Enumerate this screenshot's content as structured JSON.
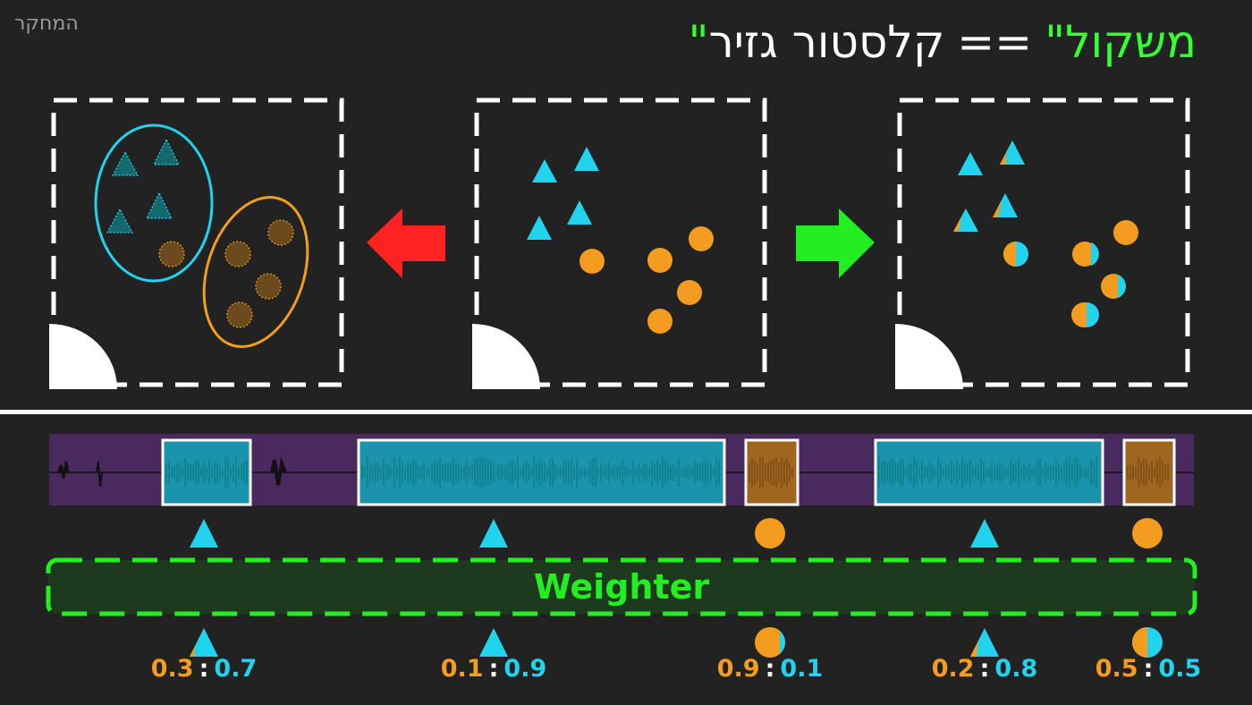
{
  "header": {
    "corner_label": "המחקר",
    "title_main": "קלסטור גזיר",
    "title_equals": "==",
    "title_highlight": "\"משקול\""
  },
  "colors": {
    "background": "#222222",
    "cyan": "#22d3ee",
    "orange": "#f39c1f",
    "green": "#22ee22",
    "red": "#ff2222",
    "purple": "#4a2a5e"
  },
  "panels": {
    "left": {
      "description_icon": "hard-clusters",
      "arrow": "red-arrow-left"
    },
    "center": {
      "description_icon": "unclustered-points"
    },
    "right": {
      "description_icon": "soft-clusters",
      "arrow": "green-arrow-right"
    }
  },
  "weighter": {
    "label": "Weighter"
  },
  "segments": [
    {
      "shape": "triangle",
      "orange": "0.3",
      "cyan": "0.7"
    },
    {
      "shape": "triangle",
      "orange": "0.1",
      "cyan": "0.9"
    },
    {
      "shape": "circle",
      "orange": "0.9",
      "cyan": "0.1"
    },
    {
      "shape": "triangle",
      "orange": "0.2",
      "cyan": "0.8"
    },
    {
      "shape": "circle",
      "orange": "0.5",
      "cyan": "0.5"
    }
  ],
  "ratio_separator": ":"
}
